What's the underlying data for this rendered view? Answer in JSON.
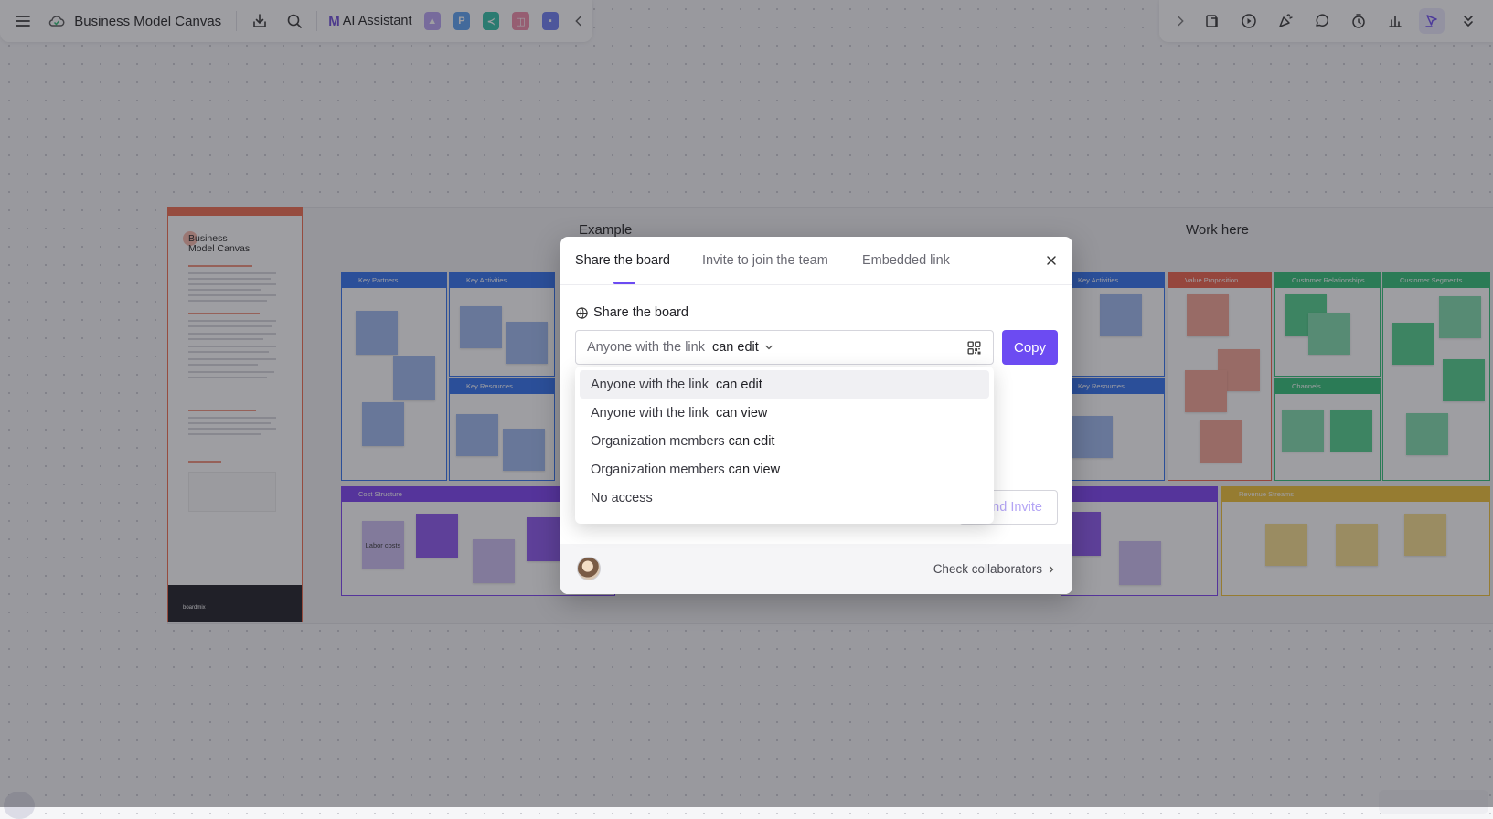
{
  "toolbar_left": {
    "title": "Business Model Canvas",
    "ai_assistant_label": "AI Assistant"
  },
  "board": {
    "info_title_line1": "Business",
    "info_title_line2": "Model Canvas",
    "example_title": "Example",
    "workhere_title": "Work here",
    "cells": {
      "key_partners": "Key Partners",
      "key_activities": "Key Activities",
      "key_resources": "Key Resources",
      "cost_structure": "Cost Structure",
      "value_proposition": "Value Proposition",
      "customer_relationships": "Customer Relationships",
      "customer_segments": "Customer Segments",
      "channels": "Channels",
      "revenue_streams": "Revenue Streams"
    },
    "notes": {
      "labor_costs": "Labor costs"
    }
  },
  "modal": {
    "tabs": [
      "Share the board",
      "Invite to join the team",
      "Embedded link"
    ],
    "active_tab_index": 0,
    "section_label": "Share the board",
    "link_prefix": "Anyone with the link",
    "link_permission": "can edit",
    "copy_label": "Copy",
    "invite_label_visible": "nd Invite",
    "check_collaborators": "Check collaborators"
  },
  "dropdown": {
    "options": [
      {
        "prefix": "Anyone with the link",
        "perm": "can edit",
        "selected": true
      },
      {
        "prefix": "Anyone with the link",
        "perm": "can view",
        "selected": false
      },
      {
        "prefix": "Organization members",
        "perm": "can edit",
        "selected": false
      },
      {
        "prefix": "Organization members",
        "perm": "can view",
        "selected": false
      },
      {
        "prefix": "No access",
        "perm": "",
        "selected": false
      }
    ]
  },
  "colors": {
    "accent": "#6c4bf2",
    "overlay": "rgba(40,40,48,0.45)"
  },
  "icons": {
    "toolbar_left": [
      "menu-icon",
      "cloud-icon",
      "download-icon",
      "search-icon"
    ],
    "toolbar_right": [
      "chevron-right-icon",
      "sticky-icon",
      "play-icon",
      "celebrate-icon",
      "comment-icon",
      "timer-icon",
      "stats-icon",
      "cursor-icon",
      "chevron-double-down-icon"
    ]
  }
}
